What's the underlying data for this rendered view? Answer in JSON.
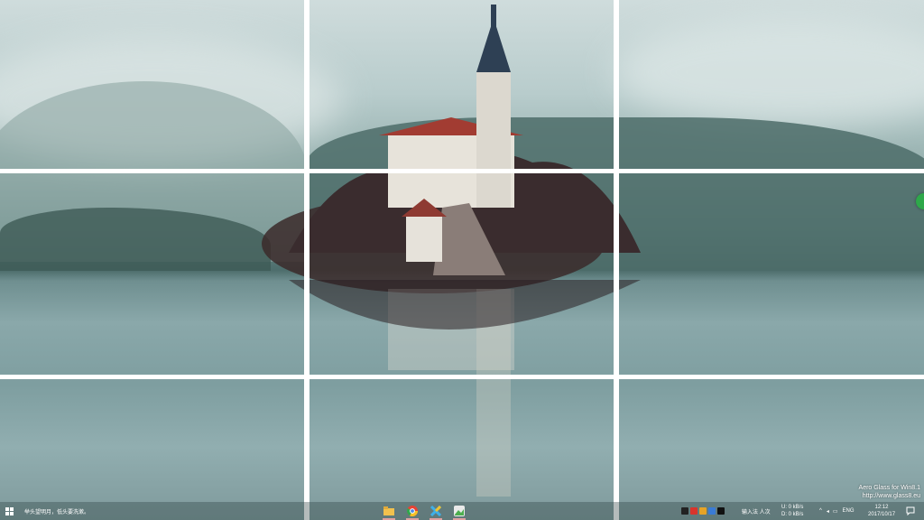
{
  "desktop": {
    "wallpaper": "lake-church-island",
    "watermark": {
      "line1": "Aero Glass for Win8.1",
      "line2": "http://www.glass8.eu"
    },
    "grid_overlay": "3x3"
  },
  "taskbar": {
    "start_icon": "windows-logo-icon",
    "status_text": "举头望明月，低头要洗漱。",
    "pinned_apps": [
      {
        "name": "file-explorer-icon",
        "color": "#f2c14e"
      },
      {
        "name": "chrome-icon",
        "color": "#e54335"
      },
      {
        "name": "cross-app-icon",
        "color": "#3fb0e8"
      },
      {
        "name": "image-app-icon",
        "color": "#4cae4f"
      }
    ],
    "tray": {
      "ime_label": "输入法 人次",
      "net_up": "0 kB/s",
      "net_down": "0 kB/s",
      "net_up_prefix": "U:",
      "net_down_prefix": "D:",
      "language": "ENG",
      "time": "12:12",
      "date": "2017/10/17"
    }
  }
}
